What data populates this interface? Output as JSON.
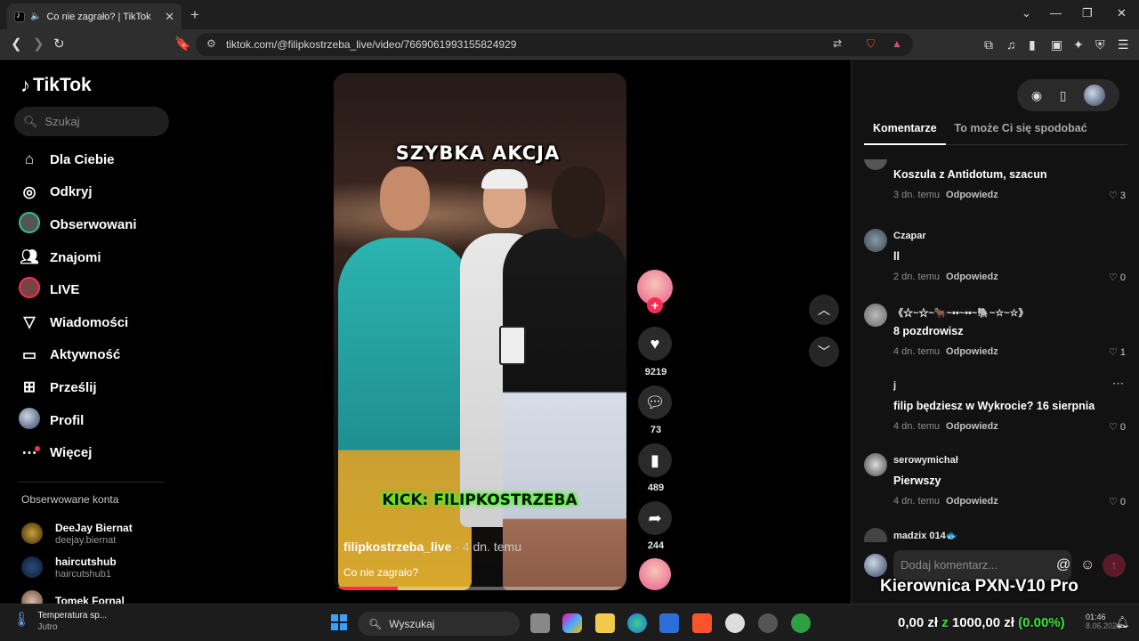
{
  "browser": {
    "tab_title": "Co nie zagrało? | TikTok",
    "tab_close": "✕",
    "new_tab": "+",
    "url": "tiktok.com/@filipkostrzeba_live/video/7669061993155824929"
  },
  "sidebar": {
    "logo": "TikTok",
    "search_placeholder": "Szukaj",
    "items": [
      {
        "label": "Dla Ciebie",
        "icon": "home-icon"
      },
      {
        "label": "Odkryj",
        "icon": "compass-icon"
      },
      {
        "label": "Obserwowani",
        "icon": "avatar"
      },
      {
        "label": "Znajomi",
        "icon": "friends-icon"
      },
      {
        "label": "LIVE",
        "icon": "live-avatar"
      },
      {
        "label": "Wiadomości",
        "icon": "send-icon"
      },
      {
        "label": "Aktywność",
        "icon": "inbox-icon"
      },
      {
        "label": "Prześlij",
        "icon": "upload-icon"
      },
      {
        "label": "Profil",
        "icon": "profile-avatar"
      },
      {
        "label": "Więcej",
        "icon": "more-icon"
      }
    ],
    "followed_title": "Obserwowane konta",
    "followed": [
      {
        "name": "DeeJay Biernat",
        "handle": "deejay.biernat"
      },
      {
        "name": "haircutshub",
        "handle": "haircutshub1"
      },
      {
        "name": "Tomek Fornal",
        "handle": ""
      }
    ]
  },
  "video": {
    "overlay_title": "SZYBKA AKCJA",
    "overlay_kick": "KICK: FILIPKOSTRZEBA",
    "author": "filipkostrzeba_live",
    "time": "· 4 dn. temu",
    "description": "Co nie zagrało?",
    "progress": 0.22
  },
  "actions": {
    "likes": "9219",
    "comments": "73",
    "saves": "489",
    "shares": "244"
  },
  "right_panel": {
    "tab_comments": "Komentarze",
    "tab_suggested": "To może Ci się spodobać",
    "comments": [
      {
        "user": "",
        "text": "Koszula z Antidotum, szacun",
        "time": "3 dn. temu",
        "reply": "Odpowiedz",
        "likes": "3"
      },
      {
        "user": "Czapar",
        "text": "ll",
        "time": "2 dn. temu",
        "reply": "Odpowiedz",
        "likes": "0"
      },
      {
        "user": "《☆~☆~🐂~••~••~🐘~☆~☆》",
        "text": "8 pozdrowisz",
        "time": "4 dn. temu",
        "reply": "Odpowiedz",
        "likes": "1"
      },
      {
        "user": "j",
        "text": "filip będziesz w Wykrocie? 16 sierpnia",
        "time": "4 dn. temu",
        "reply": "Odpowiedz",
        "likes": "0"
      },
      {
        "user": "serowymichał",
        "text": "Pierwszy",
        "time": "4 dn. temu",
        "reply": "Odpowiedz",
        "likes": "0"
      },
      {
        "user": "madzix 014🐟",
        "text": "",
        "time": "",
        "reply": "",
        "likes": ""
      }
    ],
    "input_placeholder": "Dodaj komentarz...",
    "promo": "Kierownica PXN-V10 Pro"
  },
  "taskbar": {
    "weather_title": "Temperatura sp...",
    "weather_sub": "Jutro",
    "search": "Wyszukaj",
    "money_left": "0,00 zł",
    "money_z": "z",
    "money_right": "1000,00 zł",
    "money_pct": "(0.00%)",
    "time": "01:46",
    "date": "8.06.2026"
  },
  "colors": {
    "accent": "#fe2c55",
    "kick_green": "#44ff22"
  }
}
